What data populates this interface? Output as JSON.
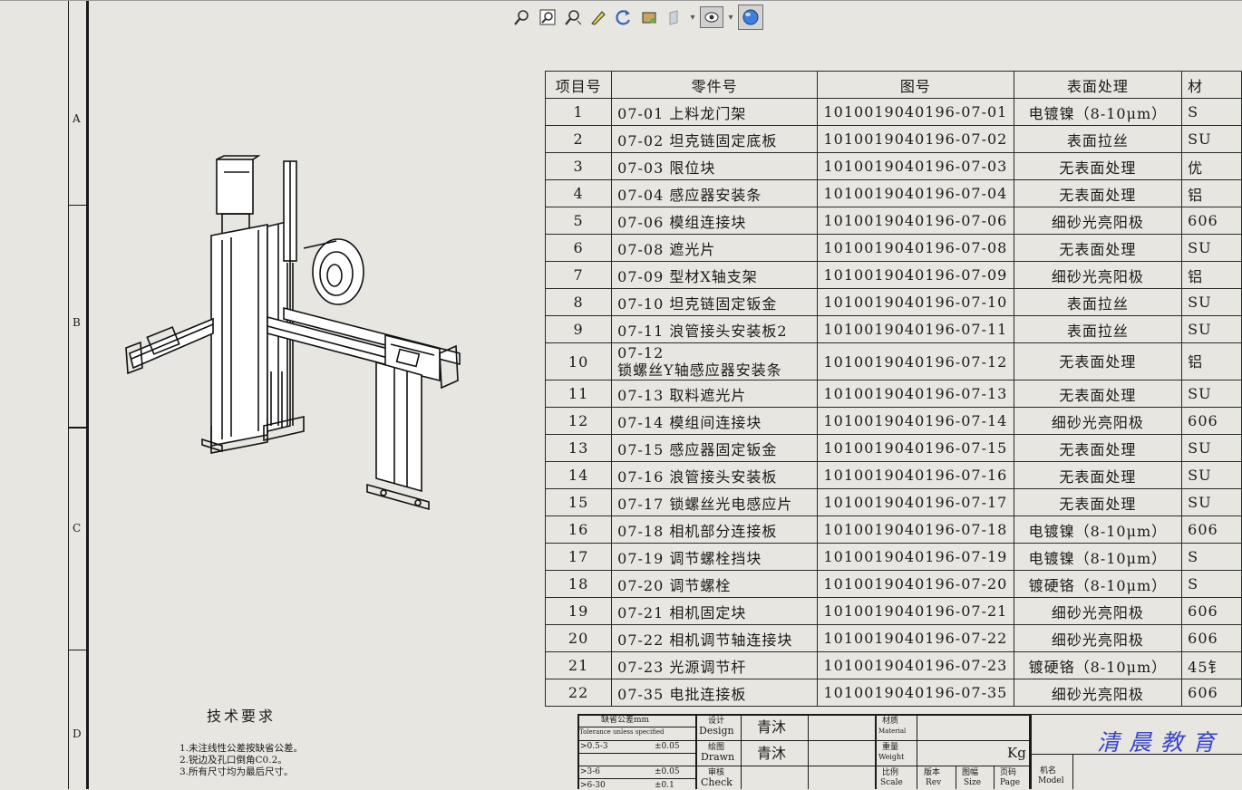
{
  "toolbar": {
    "icons": [
      "zoom-to-fit-icon",
      "zoom-area-icon",
      "zoom-in-out-icon",
      "sketch-pen-icon",
      "rotate-icon",
      "display-style-icon",
      "view-cube-icon",
      "hide-show-icon",
      "appearance-globe-icon"
    ]
  },
  "zones": [
    "A",
    "B",
    "C",
    "D"
  ],
  "bom": {
    "headers": [
      "项目号",
      "零件号",
      "图号",
      "表面处理",
      "材"
    ],
    "rows": [
      {
        "no": "1",
        "part": "07-01 上料龙门架",
        "dwg": "1010019040196-07-01",
        "surface": "电镀镍（8-10μm）",
        "mat": "S"
      },
      {
        "no": "2",
        "part": "07-02 坦克链固定底板",
        "dwg": "1010019040196-07-02",
        "surface": "表面拉丝",
        "mat": "SU"
      },
      {
        "no": "3",
        "part": "07-03 限位块",
        "dwg": "1010019040196-07-03",
        "surface": "无表面处理",
        "mat": "优"
      },
      {
        "no": "4",
        "part": "07-04 感应器安装条",
        "dwg": "1010019040196-07-04",
        "surface": "无表面处理",
        "mat": "铝"
      },
      {
        "no": "5",
        "part": "07-06 模组连接块",
        "dwg": "1010019040196-07-06",
        "surface": "细砂光亮阳极",
        "mat": "606"
      },
      {
        "no": "6",
        "part": "07-08 遮光片",
        "dwg": "1010019040196-07-08",
        "surface": "无表面处理",
        "mat": "SU"
      },
      {
        "no": "7",
        "part": "07-09  型材X轴支架",
        "dwg": "1010019040196-07-09",
        "surface": "细砂光亮阳极",
        "mat": "铝"
      },
      {
        "no": "8",
        "part": "07-10 坦克链固定钣金",
        "dwg": "1010019040196-07-10",
        "surface": "表面拉丝",
        "mat": "SU"
      },
      {
        "no": "9",
        "part": "07-11 浪管接头安装板2",
        "dwg": "1010019040196-07-11",
        "surface": "表面拉丝",
        "mat": "SU"
      },
      {
        "no": "10",
        "part": "07-12",
        "part2": "锁螺丝Y轴感应器安装条",
        "dwg": "1010019040196-07-12",
        "surface": "无表面处理",
        "mat": "铝"
      },
      {
        "no": "11",
        "part": "07-13 取料遮光片",
        "dwg": "1010019040196-07-13",
        "surface": "无表面处理",
        "mat": "SU"
      },
      {
        "no": "12",
        "part": "07-14 模组间连接块",
        "dwg": "1010019040196-07-14",
        "surface": "细砂光亮阳极",
        "mat": "606"
      },
      {
        "no": "13",
        "part": "07-15 感应器固定钣金",
        "dwg": "1010019040196-07-15",
        "surface": "无表面处理",
        "mat": "SU"
      },
      {
        "no": "14",
        "part": "07-16 浪管接头安装板",
        "dwg": "1010019040196-07-16",
        "surface": "无表面处理",
        "mat": "SU"
      },
      {
        "no": "15",
        "part": "07-17 锁螺丝光电感应片",
        "dwg": "1010019040196-07-17",
        "surface": "无表面处理",
        "mat": "SU"
      },
      {
        "no": "16",
        "part": "07-18 相机部分连接板",
        "dwg": "1010019040196-07-18",
        "surface": "电镀镍（8-10μm）",
        "mat": "606"
      },
      {
        "no": "17",
        "part": "07-19 调节螺栓挡块",
        "dwg": "1010019040196-07-19",
        "surface": "电镀镍（8-10μm）",
        "mat": "S"
      },
      {
        "no": "18",
        "part": "07-20 调节螺栓",
        "dwg": "1010019040196-07-20",
        "surface": "镀硬铬（8-10μm）",
        "mat": "S"
      },
      {
        "no": "19",
        "part": "07-21 相机固定块",
        "dwg": "1010019040196-07-21",
        "surface": "细砂光亮阳极",
        "mat": "606"
      },
      {
        "no": "20",
        "part": "07-22 相机调节轴连接块",
        "dwg": "1010019040196-07-22",
        "surface": "细砂光亮阳极",
        "mat": "606"
      },
      {
        "no": "21",
        "part": "07-23 光源调节杆",
        "dwg": "1010019040196-07-23",
        "surface": "镀硬铬（8-10μm）",
        "mat": "45钅"
      },
      {
        "no": "22",
        "part": "07-35 电批连接板",
        "dwg": "1010019040196-07-35",
        "surface": "细砂光亮阳极",
        "mat": "606"
      }
    ]
  },
  "tech_requirements": {
    "title": "技术要求",
    "items": [
      "1.未注线性公差按缺省公差。",
      "2.锐边及孔口倒角C0.2。",
      "3.所有尺寸均为最后尺寸。"
    ]
  },
  "title_block": {
    "tolerance_header": "缺省公差mm",
    "tolerance_header_en": "Tolerance unless specified",
    "tol_rows": [
      {
        "range": ">0.5-3",
        "value": "±0.05"
      },
      {
        "range": ">3-6",
        "value": "±0.05"
      },
      {
        "range": ">6-30",
        "value": "±0.1"
      }
    ],
    "design_label": "设计",
    "design_label_en": "Design",
    "design_value": "青沐",
    "drawn_label": "绘图",
    "drawn_label_en": "Drawn",
    "drawn_value": "青沐",
    "check_label": "审核",
    "check_label_en": "Check",
    "material_label": "材质",
    "material_label_en": "Material",
    "weight_label": "重量",
    "weight_label_en": "Weight",
    "weight_unit": "Kg",
    "scale_label": "比例",
    "scale_label_en": "Scale",
    "rev_label": "版本",
    "rev_label_en": "Rev",
    "size_label": "图幅",
    "size_label_en": "Size",
    "page_label": "页码",
    "page_label_en": "Page",
    "model_label": "机名",
    "model_label_en": "Model",
    "company": "清晨教育"
  },
  "colors": {
    "background": "#e7e6e0",
    "line": "#1a1a1a",
    "company_text": "#3a46c8"
  }
}
